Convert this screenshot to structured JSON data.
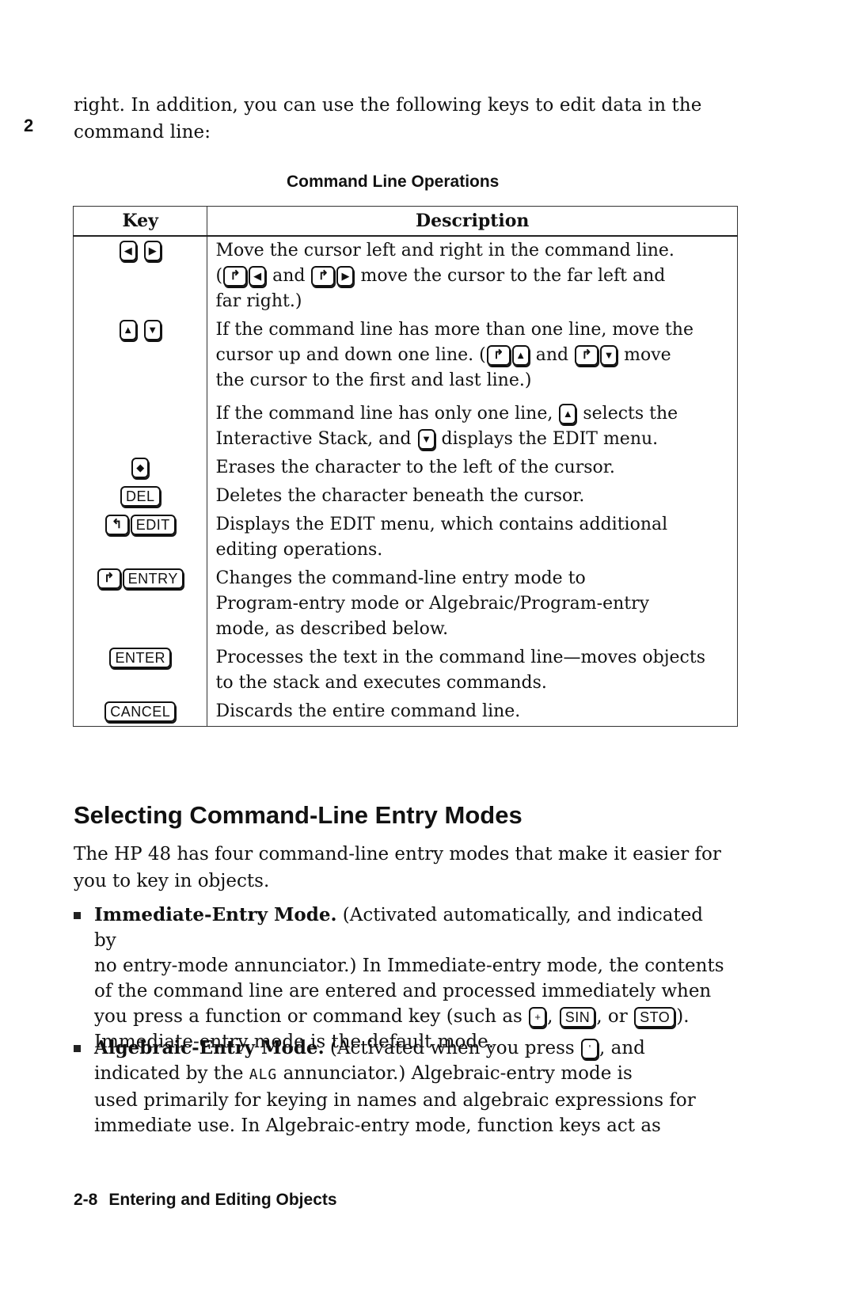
{
  "chapter_tab": "2",
  "intro": {
    "line1": "right. In addition, you can use the following keys to edit data in the",
    "line2": "command line:"
  },
  "table": {
    "title": "Command Line Operations",
    "headers": {
      "key": "Key",
      "description": "Description"
    },
    "rows": [
      {
        "keys": [
          "◀",
          "▶"
        ],
        "desc": [
          "Move the cursor left and right in the command line.",
          "and",
          "move the cursor to the far left and",
          "far right.)"
        ]
      },
      {
        "keys": [
          "▲",
          "▼"
        ],
        "desc": [
          "If the command line has more than one line, move the",
          "cursor up and down one line. (",
          "and",
          "move",
          "the cursor to the first and last line.)",
          "If the command line has only one line,",
          "selects the",
          "Interactive Stack, and",
          "displays the EDIT menu."
        ]
      },
      {
        "keys": [
          "◆"
        ],
        "desc": [
          "Erases the character to the left of the cursor."
        ]
      },
      {
        "keys": [
          "DEL"
        ],
        "desc": [
          "Deletes the character beneath the cursor."
        ]
      },
      {
        "keys": [
          "↰",
          "EDIT"
        ],
        "desc": [
          "Displays the EDIT menu, which contains additional",
          "editing operations."
        ]
      },
      {
        "keys": [
          "↱",
          "ENTRY"
        ],
        "desc": [
          "Changes the command-line entry mode to",
          "Program-entry mode or Algebraic/Program-entry",
          "mode, as described below."
        ]
      },
      {
        "keys": [
          "ENTER"
        ],
        "desc": [
          "Processes the text in the command line—moves objects",
          "to the stack and executes commands."
        ]
      },
      {
        "keys": [
          "CANCEL"
        ],
        "desc": [
          "Discards the entire command line."
        ]
      }
    ]
  },
  "section": {
    "heading": "Selecting Command-Line Entry Modes",
    "intro_line1": "The HP 48 has four command-line entry modes that make it easier for",
    "intro_line2": "you to key in objects.",
    "bullets": [
      {
        "title": "Immediate-Entry Mode.",
        "l1": "(Activated automatically, and indicated by",
        "l2": "no entry-mode annunciator.) In Immediate-entry mode, the contents",
        "l3": "of the command line are entered and processed immediately when",
        "l4a": "you press a function or command key (such as",
        "k1": "+",
        "k2": "SIN",
        "sep1": ",",
        "sep2": ", or",
        "k3": "STO",
        "l4b": ").",
        "l5": "Immediate-entry mode is the default mode."
      },
      {
        "title": "Algebraic-Entry Mode.",
        "l1a": "(Activated when you press",
        "k1": "'",
        "l1b": ", and",
        "l2a": "indicated by the",
        "annunciator": "ALG",
        "l2b": "annunciator.) Algebraic-entry mode is",
        "l3": "used primarily for keying in names and algebraic expressions for",
        "l4": "immediate use. In Algebraic-entry mode, function keys act as"
      }
    ]
  },
  "footer": {
    "page": "2-8",
    "title": "Entering and Editing Objects"
  }
}
